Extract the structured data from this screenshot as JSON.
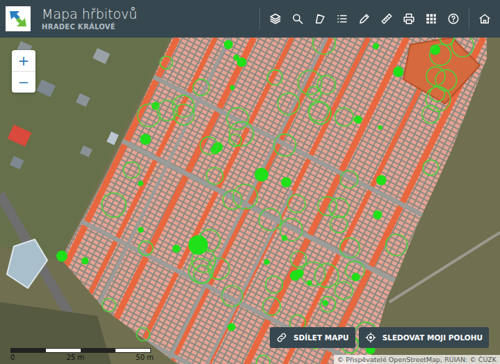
{
  "header": {
    "title": "Mapa hřbitovů",
    "subtitle": "HRADEC KRÁLOVÉ"
  },
  "zoom": {
    "in": "+",
    "out": "−"
  },
  "buttons": [
    {
      "label": "SDÍLET MAPU"
    },
    {
      "label": "SLEDOVAT MOJI POLOHU"
    }
  ],
  "scale": {
    "ticks": [
      "0",
      "25 m",
      "50 m"
    ]
  },
  "attribution": "© Přispěvatelé OpenStreetMap, RÚIAN: © ČÚZK"
}
